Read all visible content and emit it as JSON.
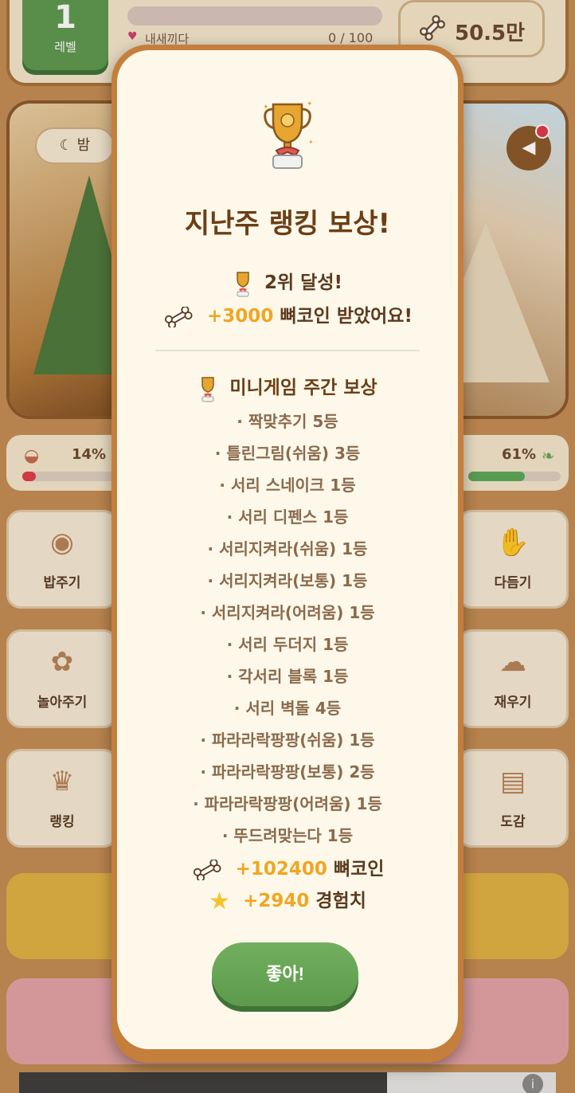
{
  "top_bar": {
    "level_number": "1",
    "level_label": "레벨",
    "xp_name": "내새끼다",
    "xp_count": "0 / 100",
    "coins": "50.5만"
  },
  "scene": {
    "time_of_day": "밤"
  },
  "stats": {
    "hunger_percent": "14%",
    "hunger_value": 0.14,
    "other_percent": "61%",
    "other_value": 0.61
  },
  "tiles": {
    "feed": "밥주기",
    "pet": "다듬기",
    "play": "놀아주기",
    "sleep": "재우기",
    "ranking": "랭킹",
    "collection": "도감"
  },
  "modal": {
    "title": "지난주 랭킹 보상!",
    "rank_text": "2위 달성!",
    "reward_amount": "+3000",
    "reward_text": "뼈코인 받았어요!",
    "section_title": "미니게임 주간 보상",
    "items": [
      "· 짝맞추기 5등",
      "· 틀린그림(쉬움) 3등",
      "· 서리 스네이크 1등",
      "· 서리 디펜스 1등",
      "· 서리지켜라(쉬움) 1등",
      "· 서리지켜라(보통) 1등",
      "· 서리지켜라(어려움) 1등",
      "· 서리 두더지 1등",
      "· 각서리 블록 1등",
      "· 서리 벽돌 4등",
      "· 파라라락팡팡(쉬움) 1등",
      "· 파라라락팡팡(보통) 2등",
      "· 파라라락팡팡(어려움) 1등",
      "· 뚜드려맞는다 1등"
    ],
    "total_coins": "+102400",
    "total_coins_label": "뼈코인",
    "total_xp": "+2940",
    "total_xp_label": "경험치",
    "ok_label": "좋아!"
  },
  "colors": {
    "accent_gold": "#f0a622",
    "button_green": "#5d9a4c",
    "frame_brown": "#c47f3c",
    "title_brown": "#6b3f16"
  }
}
